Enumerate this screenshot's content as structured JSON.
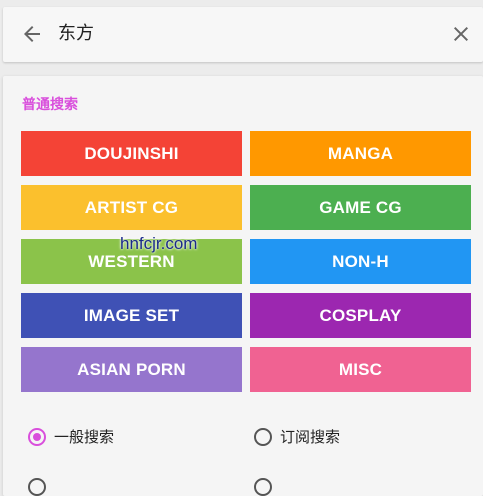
{
  "search": {
    "query": "东方",
    "back_icon": "arrow-left-icon",
    "clear_icon": "close-icon"
  },
  "normal_search": {
    "title": "普通搜索",
    "categories": [
      {
        "label": "DOUJINSHI",
        "color": "#f44336"
      },
      {
        "label": "MANGA",
        "color": "#ff9800"
      },
      {
        "label": "ARTIST CG",
        "color": "#fbc02d"
      },
      {
        "label": "GAME CG",
        "color": "#4caf50"
      },
      {
        "label": "WESTERN",
        "color": "#8bc34a"
      },
      {
        "label": "NON-H",
        "color": "#2196f3"
      },
      {
        "label": "IMAGE SET",
        "color": "#3f51b5"
      },
      {
        "label": "COSPLAY",
        "color": "#9c27b0"
      },
      {
        "label": "ASIAN PORN",
        "color": "#9575cd"
      },
      {
        "label": "MISC",
        "color": "#f06292"
      }
    ],
    "search_modes": [
      {
        "label": "一般搜索",
        "checked": true
      },
      {
        "label": "订阅搜索",
        "checked": false
      }
    ]
  },
  "watermark": "hnfcjr.com",
  "accent_color": "#d94fdc"
}
